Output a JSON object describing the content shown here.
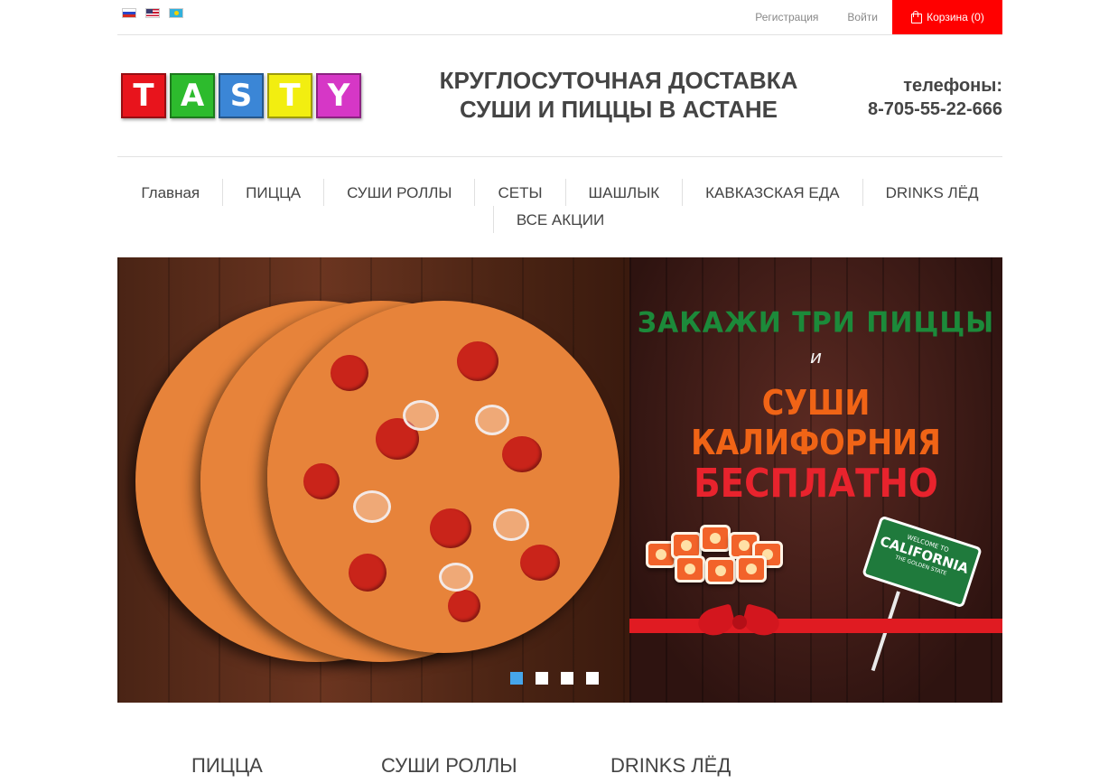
{
  "topbar": {
    "flags": [
      "flag-ru-icon",
      "flag-us-icon",
      "flag-kz-icon"
    ],
    "register_label": "Регистрация",
    "login_label": "Войти",
    "cart_label": "Корзина (0)"
  },
  "header": {
    "logo_letters": [
      "T",
      "A",
      "S",
      "T",
      "Y"
    ],
    "logo_colors": [
      "#e8141c",
      "#2dbb2d",
      "#3b86d6",
      "#f2ee10",
      "#d637c6"
    ],
    "tagline_line1": "КРУГЛОСУТОЧНАЯ ДОСТАВКА",
    "tagline_line2": "СУШИ И ПИЦЦЫ В АСТАНЕ",
    "phones_label": "телефоны:",
    "phone_number": "8-705-55-22-666"
  },
  "nav": {
    "items": [
      "Главная",
      "ПИЦЦА",
      "СУШИ РОЛЛЫ",
      "СЕТЫ",
      "ШАШЛЫК",
      "КАВКАЗСКАЯ ЕДА",
      "DRINKS ЛЁД",
      "ВСЕ АКЦИИ"
    ]
  },
  "slider": {
    "promo_line1": "ЗАКАЖИ ТРИ ПИЦЦЫ",
    "promo_line2": "и",
    "promo_line3": "СУШИ КАЛИФОРНИЯ",
    "promo_line4": "БЕСПЛАТНО",
    "sign_line1": "WELCOME TO",
    "sign_line2": "CALIFORNIA",
    "sign_line3": "THE GOLDEN STATE",
    "active_slide": 1,
    "slide_count": 4
  },
  "categories": [
    "ПИЦЦА",
    "СУШИ РОЛЛЫ",
    "DRINKS ЛЁД"
  ],
  "colors": {
    "accent_red": "#ff0000",
    "active_dot": "#46a6ec"
  }
}
